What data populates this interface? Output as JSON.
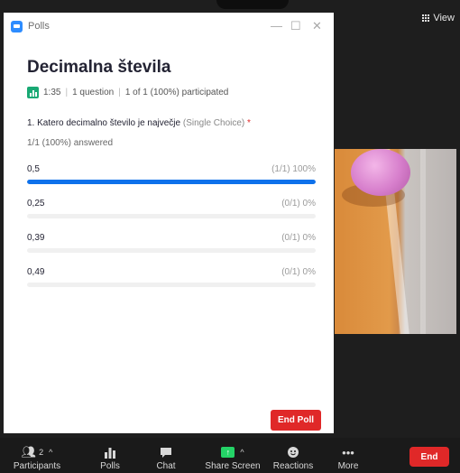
{
  "window": {
    "title": "Polls",
    "minimize": "—",
    "maximize": "☐",
    "close": "✕"
  },
  "view": {
    "label": "View"
  },
  "poll": {
    "title": "Decimalna števila",
    "meta": {
      "duration": "1:35",
      "questions": "1 question",
      "participated": "1 of 1 (100%) participated"
    },
    "question": {
      "text": "1. Katero decimalno število je največje",
      "type": "(Single Choice)",
      "required_marker": "*"
    },
    "answered": "1/1 (100%) answered",
    "options": [
      {
        "label": "0,5",
        "result": "(1/1) 100%",
        "fraction": 1.0
      },
      {
        "label": "0,25",
        "result": "(0/1) 0%",
        "fraction": 0.0
      },
      {
        "label": "0,39",
        "result": "(0/1) 0%",
        "fraction": 0.0
      },
      {
        "label": "0,49",
        "result": "(0/1) 0%",
        "fraction": 0.0
      }
    ],
    "end_poll_label": "End Poll"
  },
  "toolbar": {
    "participants": {
      "label": "Participants",
      "count": "2"
    },
    "polls": {
      "label": "Polls"
    },
    "chat": {
      "label": "Chat"
    },
    "share": {
      "label": "Share Screen"
    },
    "reactions": {
      "label": "Reactions"
    },
    "more": {
      "label": "More"
    },
    "end": {
      "label": "End"
    }
  },
  "colors": {
    "accent": "#0e71eb",
    "end": "#e02828",
    "share": "#24d367",
    "poll_icon": "#19a974"
  }
}
